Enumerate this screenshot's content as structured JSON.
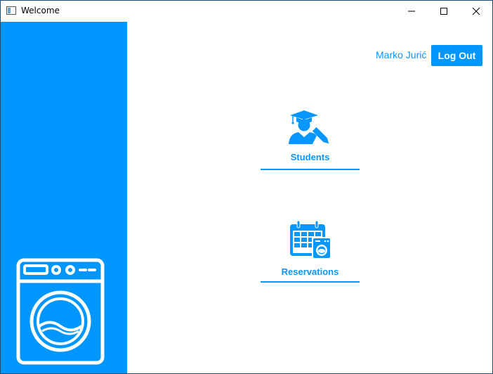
{
  "window": {
    "title": "Welcome"
  },
  "header": {
    "user_name": "Marko Jurić",
    "logout_label": "Log Out"
  },
  "tiles": [
    {
      "label": "Students",
      "icon": "student-icon"
    },
    {
      "label": "Reservations",
      "icon": "calendar-washer-icon"
    }
  ],
  "sidebar": {
    "icon": "washing-machine-icon"
  },
  "colors": {
    "accent": "#0096ff",
    "text_accent": "#0a96ff",
    "background": "#ffffff"
  }
}
